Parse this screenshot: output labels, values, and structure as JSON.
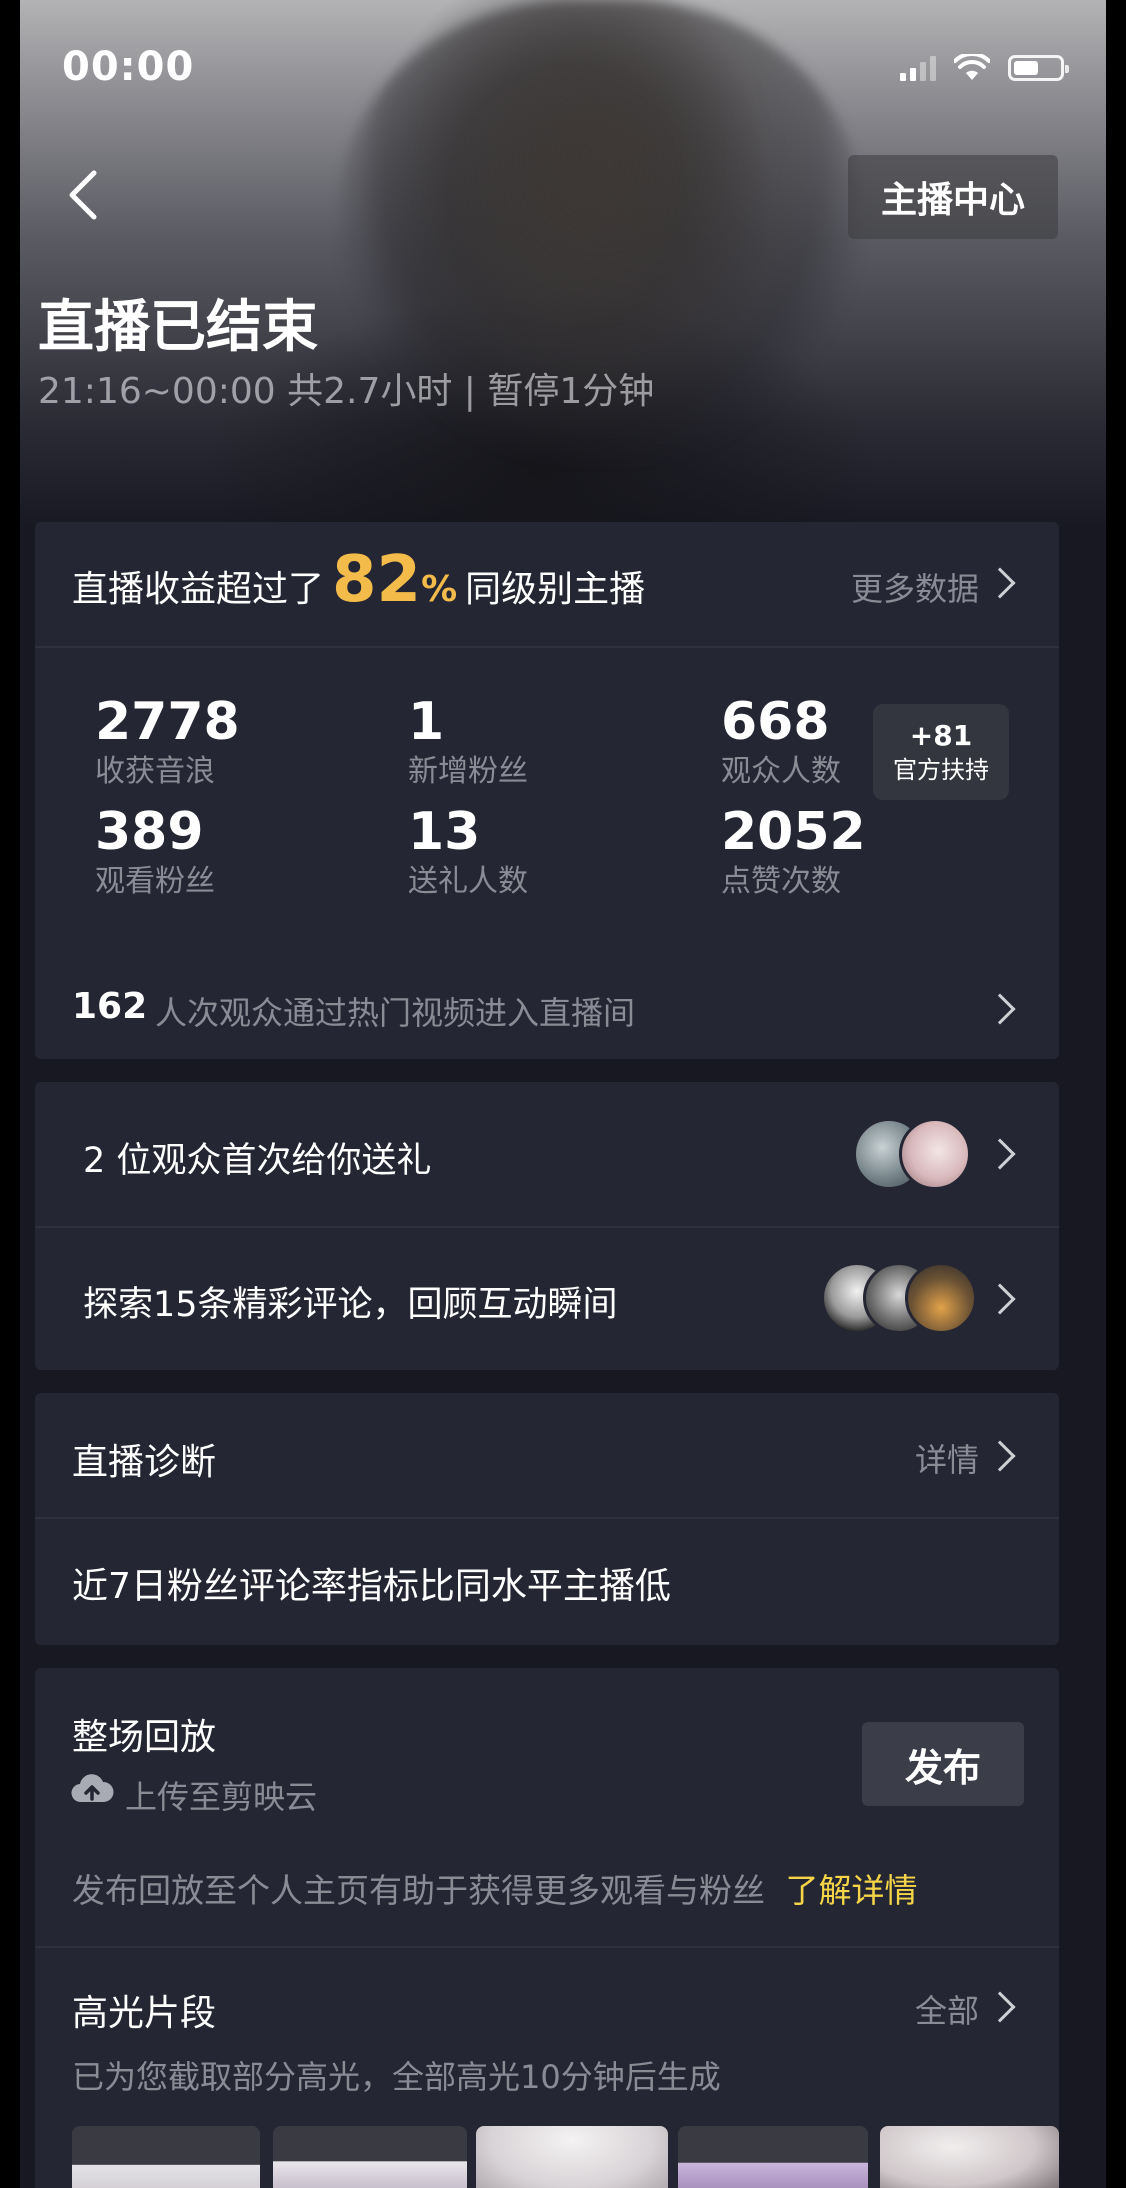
{
  "status_bar": {
    "time": "00:00"
  },
  "header": {
    "host_center_label": "主播中心",
    "title": "直播已结束",
    "subtitle": "21:16~00:00 共2.7小时 | 暂停1分钟"
  },
  "earnings": {
    "text_before": "直播收益超过了",
    "percent": "82",
    "percent_sign": "%",
    "text_after": "同级别主播",
    "more_label": "更多数据"
  },
  "stats": [
    {
      "value": "2778",
      "label": "收获音浪"
    },
    {
      "value": "1",
      "label": "新增粉丝"
    },
    {
      "value": "668",
      "label": "观众人数"
    },
    {
      "value": "389",
      "label": "观看粉丝"
    },
    {
      "value": "13",
      "label": "送礼人数"
    },
    {
      "value": "2052",
      "label": "点赞次数"
    }
  ],
  "official_support": {
    "value": "+81",
    "label": "官方扶持"
  },
  "hot_video": {
    "count": "162",
    "text": "人次观众通过热门视频进入直播间"
  },
  "gifts": {
    "text": "2 位观众首次给你送礼"
  },
  "comments": {
    "text": "探索15条精彩评论，回顾互动瞬间"
  },
  "diagnosis": {
    "title": "直播诊断",
    "detail_label": "详情",
    "message": "近7日粉丝评论率指标比同水平主播低"
  },
  "replay": {
    "title": "整场回放",
    "upload_label": "上传至剪映云",
    "publish_label": "发布",
    "hint": "发布回放至个人主页有助于获得更多观看与粉丝",
    "learn_more": "了解详情"
  },
  "highlights": {
    "title": "高光片段",
    "all_label": "全部",
    "hint": "已为您截取部分高光，全部高光10分钟后生成"
  },
  "colors": {
    "accent_gold": "#f2bb4a",
    "link_yellow": "#f5d547",
    "background": "#171822",
    "card": "#242633"
  }
}
